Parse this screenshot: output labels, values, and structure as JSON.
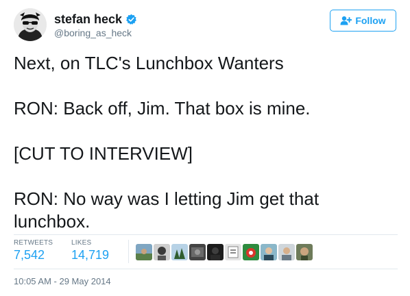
{
  "user": {
    "name": "stefan heck",
    "handle": "@boring_as_heck",
    "avatar_icon": "avatar-sunglasses-icon",
    "verified_icon": "verified-badge-icon"
  },
  "follow_button": {
    "label": "Follow",
    "icon": "follow-user-plus-icon"
  },
  "tweet": {
    "paragraphs": [
      "Next, on TLC's Lunchbox Wanters",
      "RON: Back off, Jim. That box is mine.",
      "[CUT TO INTERVIEW]",
      "RON: No way was I letting Jim get that lunchbox."
    ]
  },
  "stats": {
    "retweets_label": "RETWEETS",
    "retweets_count": "7,542",
    "likes_label": "LIKES",
    "likes_count": "14,719"
  },
  "likers": [
    "liker-avatar",
    "liker-avatar",
    "liker-avatar",
    "liker-avatar",
    "liker-avatar",
    "liker-avatar",
    "liker-avatar",
    "liker-avatar",
    "liker-avatar",
    "liker-avatar"
  ],
  "timestamp": "10:05 AM - 29 May 2014",
  "colors": {
    "accent": "#1da1f2",
    "text": "#14171a",
    "muted": "#657786",
    "divider": "#e1e8ed"
  }
}
